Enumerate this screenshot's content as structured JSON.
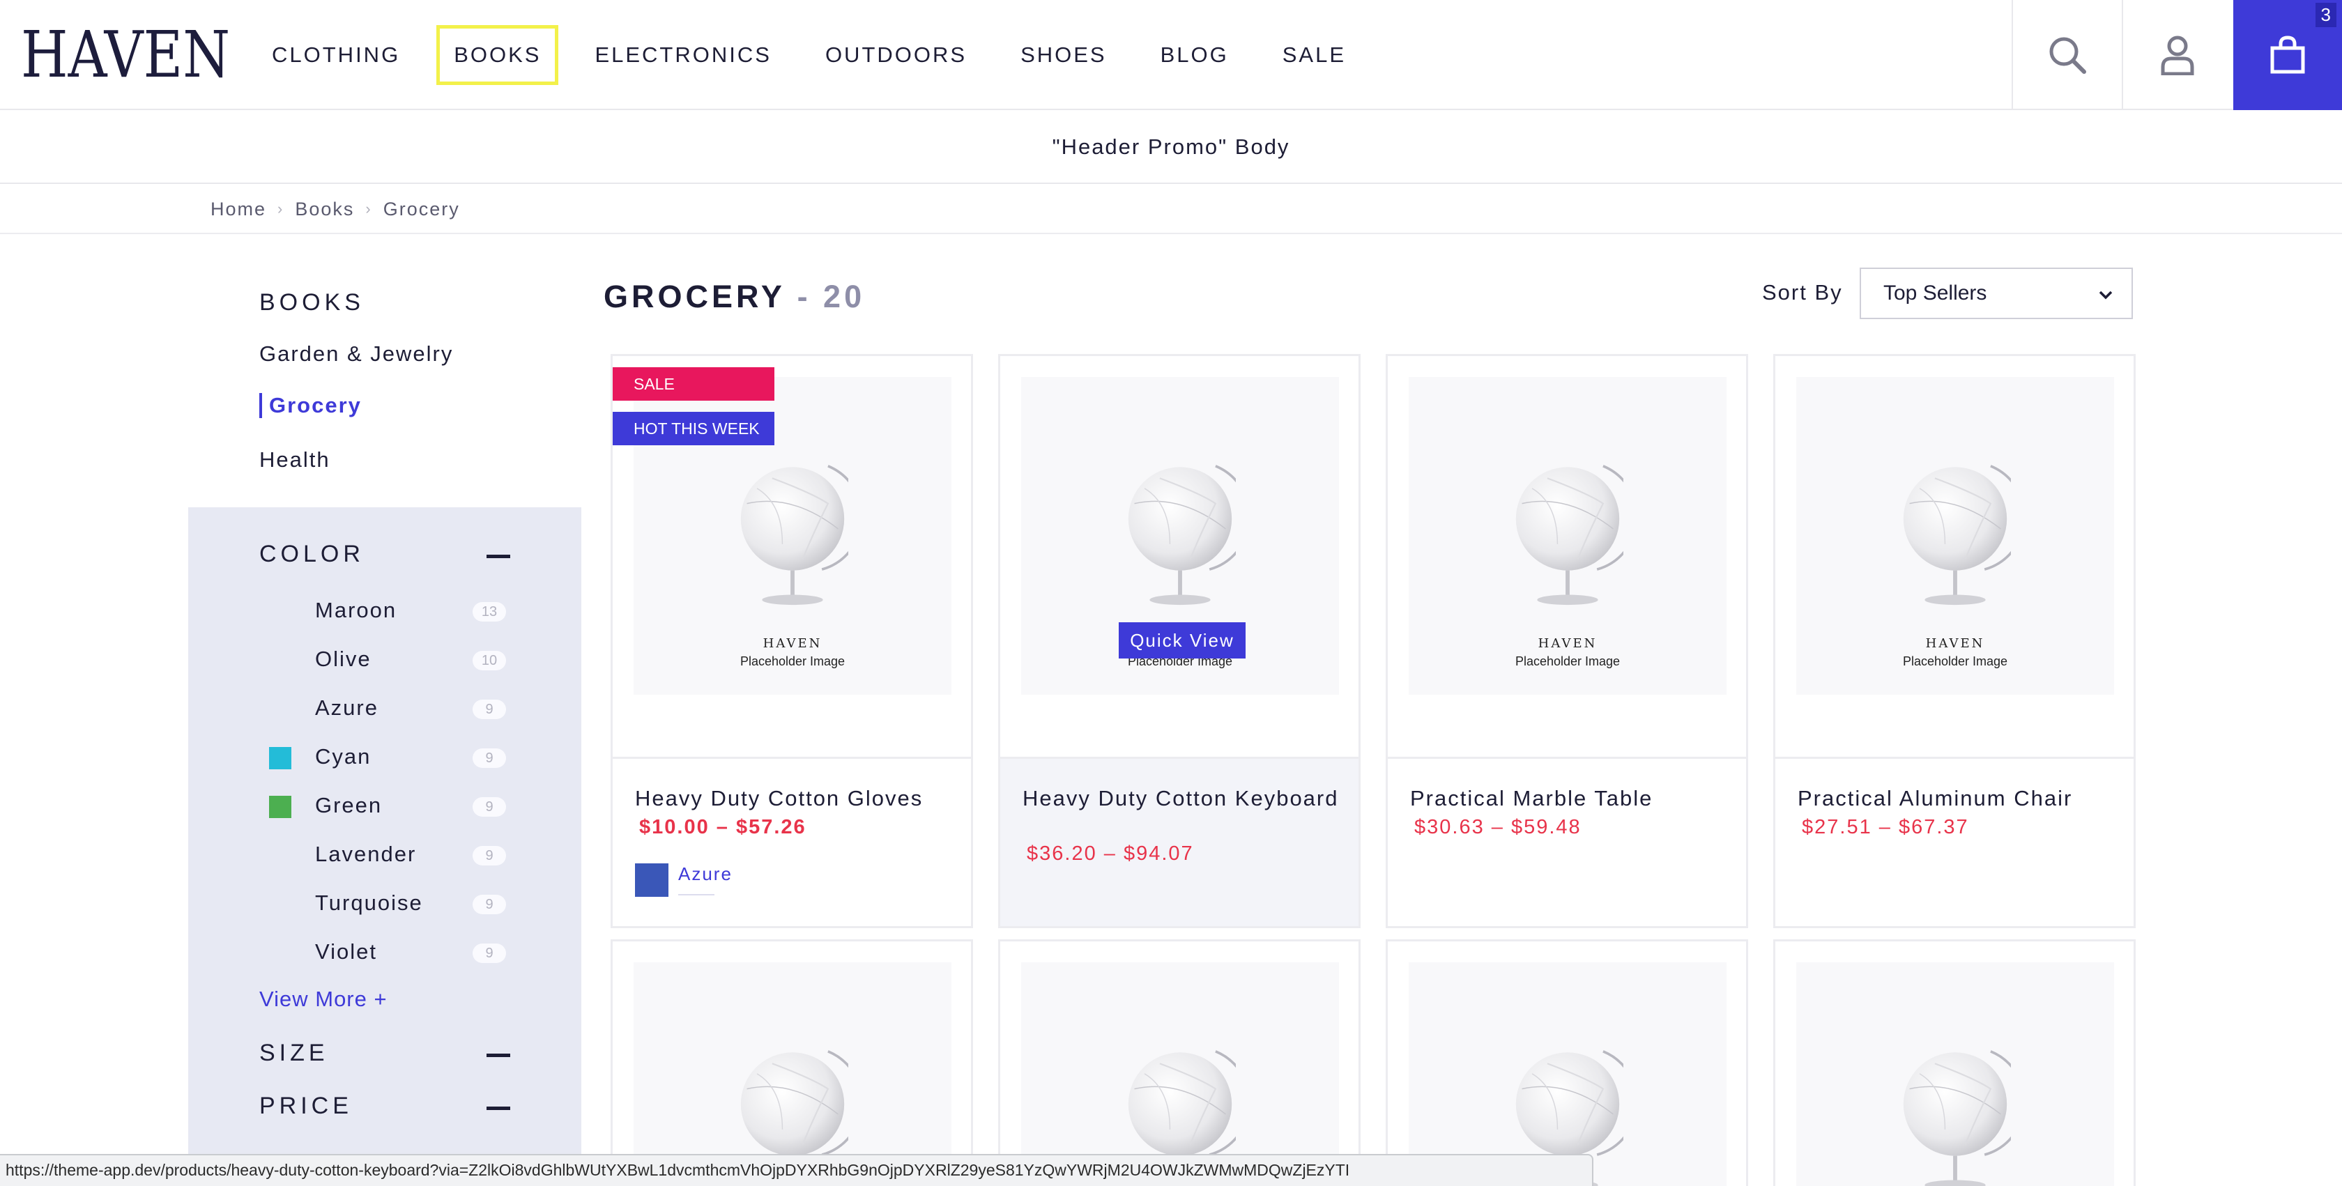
{
  "header": {
    "logo_text": "HAVEN",
    "nav": [
      "CLOTHING",
      "BOOKS",
      "ELECTRONICS",
      "OUTDOORS",
      "SHOES",
      "BLOG",
      "SALE"
    ],
    "cart_count": "3"
  },
  "promo": {
    "text": "\"Header Promo\" Body"
  },
  "breadcrumb": [
    "Home",
    "Books",
    "Grocery"
  ],
  "sidebar": {
    "category_title": "BOOKS",
    "categories": [
      "Garden & Jewelry",
      "Grocery",
      "Health"
    ],
    "filters": {
      "color_title": "COLOR",
      "colors": [
        {
          "label": "Maroon",
          "count": "13",
          "swatch": ""
        },
        {
          "label": "Olive",
          "count": "10",
          "swatch": ""
        },
        {
          "label": "Azure",
          "count": "9",
          "swatch": ""
        },
        {
          "label": "Cyan",
          "count": "9",
          "swatch": "#23bcd8"
        },
        {
          "label": "Green",
          "count": "9",
          "swatch": "#4caf50"
        },
        {
          "label": "Lavender",
          "count": "9",
          "swatch": ""
        },
        {
          "label": "Turquoise",
          "count": "9",
          "swatch": ""
        },
        {
          "label": "Violet",
          "count": "9",
          "swatch": ""
        }
      ],
      "view_more": "View More  +",
      "size_title": "SIZE",
      "price_title": "PRICE"
    }
  },
  "main": {
    "title": "GROCERY",
    "count": "- 20",
    "sort_label": "Sort By",
    "sort_value": "Top Sellers"
  },
  "placeholder": {
    "logo": "HAVEN",
    "text": "Placeholder Image"
  },
  "products": [
    {
      "name": "Heavy Duty Cotton Gloves",
      "price": "$10.00 – $57.26",
      "badges": [
        "SALE",
        "HOT THIS WEEK"
      ],
      "variant": "Azure"
    },
    {
      "name": "Heavy Duty Cotton Keyboard",
      "price": "$36.20 – $94.07",
      "quick_view": "Quick View"
    },
    {
      "name": "Practical Marble Table",
      "price": "$30.63 – $59.48"
    },
    {
      "name": "Practical Aluminum Chair",
      "price": "$27.51 – $67.37"
    }
  ],
  "status_bar": {
    "url": "https://theme-app.dev/products/heavy-duty-cotton-keyboard?via=Z2lkOi8vdGhlbWUtYXBwL1dvcmthcmVhOjpDYXRhbG9nOjpDYXRlZ29yeS81YzQwYWRjM2U4OWJkZWMwMDQwZjEzYTI"
  },
  "colors": {
    "accent": "#3e3ad8",
    "sale": "#e8175d",
    "price": "#e8334a",
    "nav_highlight": "#f3f14a"
  },
  "icons": [
    "search-icon",
    "user-icon",
    "bag-icon",
    "chevron-down-icon",
    "minus-icon",
    "globe-placeholder"
  ]
}
